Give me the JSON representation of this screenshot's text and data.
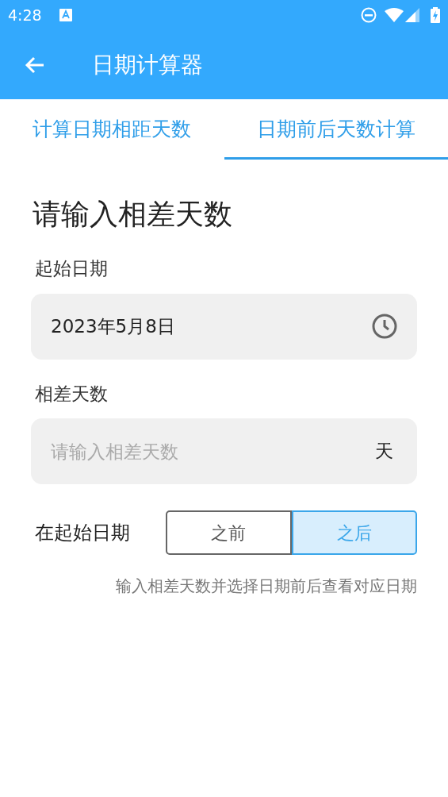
{
  "status_bar": {
    "time": "4:28"
  },
  "app_bar": {
    "title": "日期计算器"
  },
  "tabs": [
    {
      "label": "计算日期相距天数",
      "selected": false
    },
    {
      "label": "日期前后天数计算",
      "selected": true
    }
  ],
  "heading": "请输入相差天数",
  "start_date": {
    "label": "起始日期",
    "value": "2023年5月8日"
  },
  "days": {
    "label": "相差天数",
    "placeholder": "请输入相差天数",
    "unit": "天"
  },
  "direction": {
    "label": "在起始日期",
    "options": [
      {
        "label": "之前",
        "selected": false
      },
      {
        "label": "之后",
        "selected": true
      }
    ]
  },
  "hint": "输入相差天数并选择日期前后查看对应日期"
}
